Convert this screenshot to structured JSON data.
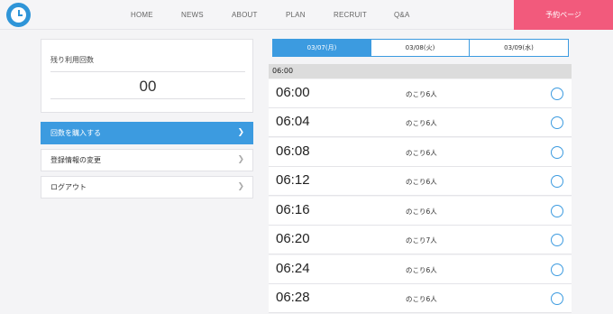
{
  "nav": {
    "items": [
      "HOME",
      "NEWS",
      "ABOUT",
      "PLAN",
      "RECRUIT",
      "Q&A"
    ],
    "reserve_label": "予約ページ"
  },
  "remaining": {
    "label": "残り利用回数",
    "value": "00"
  },
  "menu": [
    {
      "label": "回数を購入する",
      "active": true
    },
    {
      "label": "登録情報の変更",
      "active": false
    },
    {
      "label": "ログアウト",
      "active": false
    }
  ],
  "dates": [
    {
      "label": "03/07(月)",
      "active": true
    },
    {
      "label": "03/08(火)",
      "active": false
    },
    {
      "label": "03/09(水)",
      "active": false
    }
  ],
  "hour_header": "06:00",
  "slots": [
    {
      "time": "06:00",
      "remaining": "のこり6人"
    },
    {
      "time": "06:04",
      "remaining": "のこり6人"
    },
    {
      "time": "06:08",
      "remaining": "のこり6人"
    },
    {
      "time": "06:12",
      "remaining": "のこり6人"
    },
    {
      "time": "06:16",
      "remaining": "のこり6人"
    },
    {
      "time": "06:20",
      "remaining": "のこり7人"
    },
    {
      "time": "06:24",
      "remaining": "のこり6人"
    },
    {
      "time": "06:28",
      "remaining": "のこり6人"
    }
  ],
  "colors": {
    "accent": "#3c9be0",
    "reserve": "#f25a7c",
    "logo": "#2f95d8"
  }
}
